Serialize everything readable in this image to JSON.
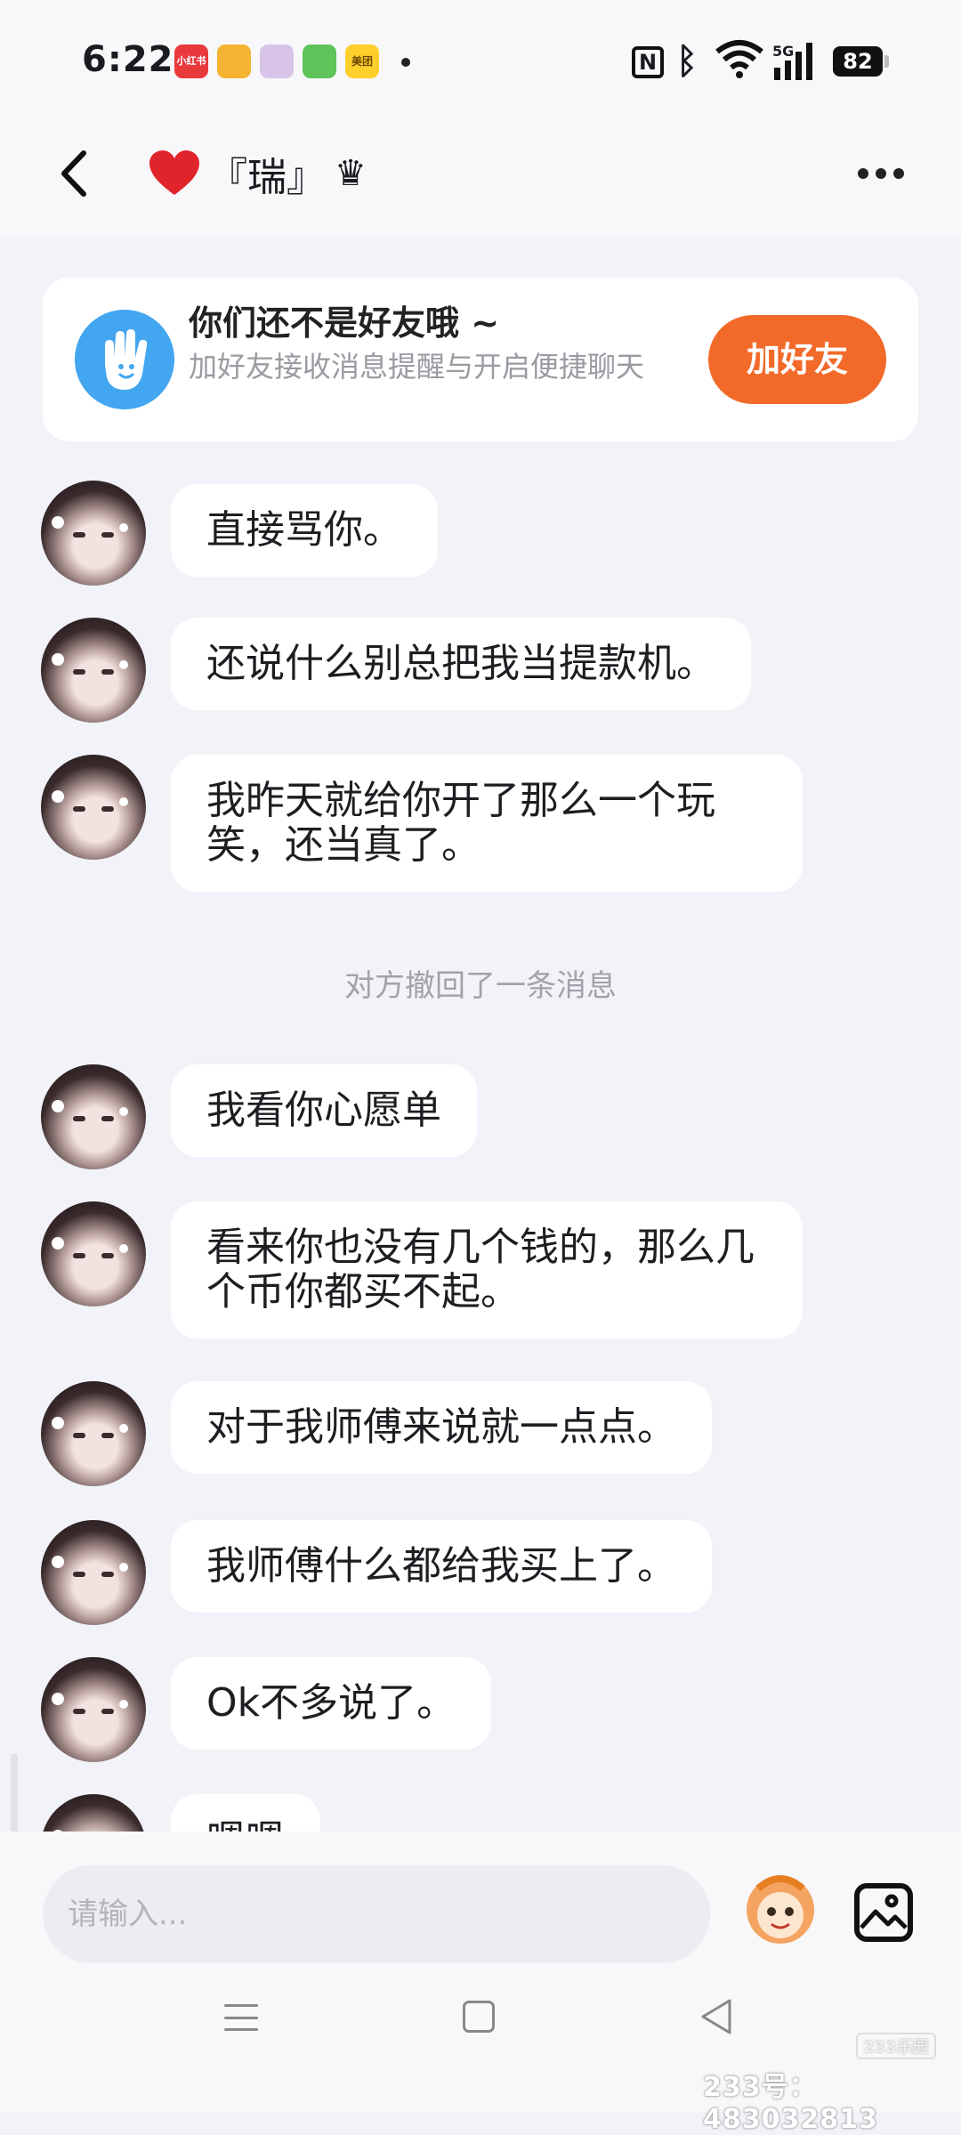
{
  "status_bar": {
    "time": "6:22",
    "apps": [
      {
        "name": "小红书",
        "color": "#e8393d"
      },
      {
        "name": "",
        "color": "#f4b330"
      },
      {
        "name": "",
        "color": "#d8c4e8"
      },
      {
        "name": "",
        "color": "#5fc45a"
      },
      {
        "name": "美团",
        "color": "#ffcf2c"
      }
    ],
    "network": "5G",
    "battery": "82"
  },
  "header": {
    "title": "『瑞』",
    "title_prefix_icon": "red-heart-icon",
    "title_suffix_glyph": "♛"
  },
  "banner": {
    "title": "你们还不是好友哦 ~",
    "subtitle": "加好友接收消息提醒与开启便捷聊天",
    "button": "加好友"
  },
  "messages": [
    {
      "text": "直接骂你。"
    },
    {
      "text": "还说什么别总把我当提款机。"
    },
    {
      "text": "我昨天就给你开了那么一个玩笑，还当真了。"
    },
    {
      "text": "我看你心愿单"
    },
    {
      "text": "看来你也没有几个钱的，那么几个币你都买不起。"
    },
    {
      "text": "对于我师傅来说就一点点。"
    },
    {
      "text": "我师傅什么都给我买上了。"
    },
    {
      "text": "Ok不多说了。"
    },
    {
      "text": "嗯嗯"
    }
  ],
  "system_message": "对方撤回了一条消息",
  "input": {
    "placeholder": "请输入..."
  },
  "watermark": {
    "logo": "233乐园",
    "text": "233号：483032813"
  },
  "colors": {
    "accent": "#f26a2a",
    "hand_icon_bg": "#42a6f0",
    "background": "#f1f3f9"
  }
}
